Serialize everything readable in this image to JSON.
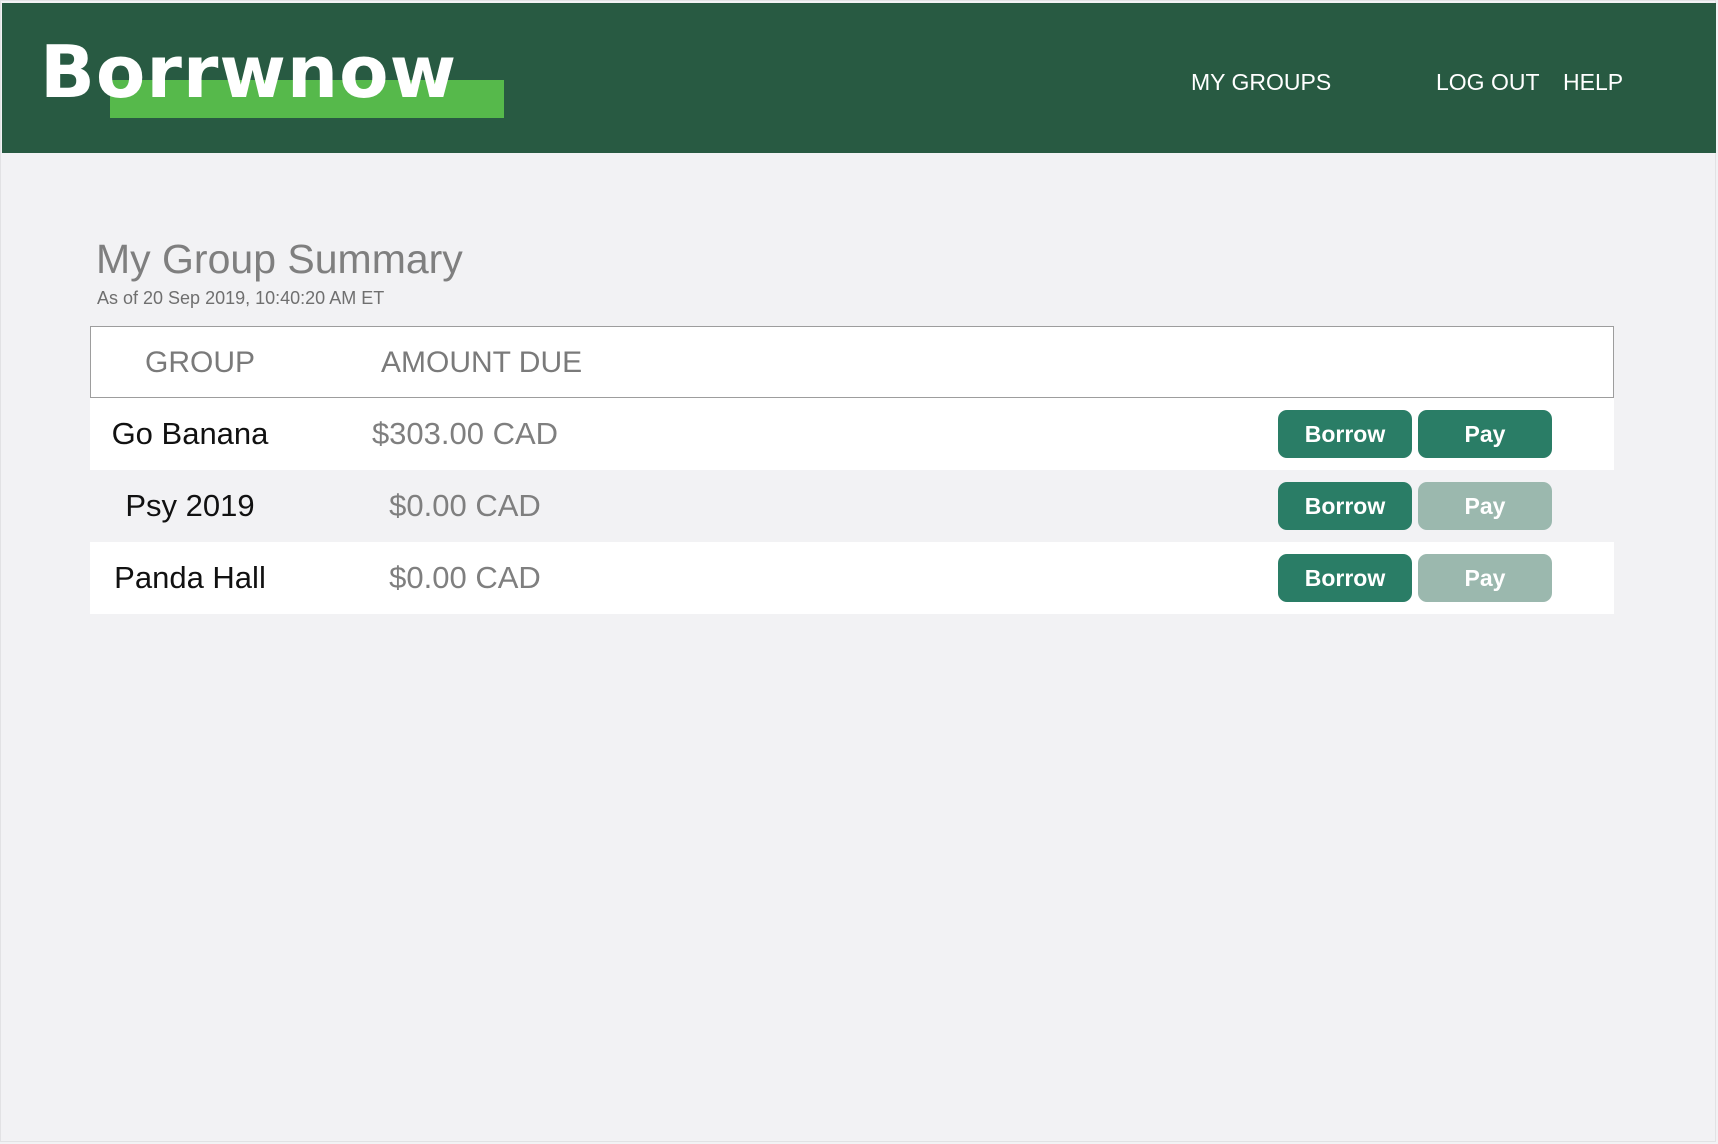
{
  "header": {
    "logo": "Borrwnow",
    "nav": {
      "my_groups": "MY GROUPS",
      "log_out": "LOG OUT",
      "help": "HELP"
    }
  },
  "summary": {
    "title": "My Group Summary",
    "as_of": "As of 20 Sep 2019, 10:40:20 AM ET"
  },
  "table": {
    "columns": {
      "group": "GROUP",
      "amount_due": "AMOUNT DUE"
    },
    "rows": [
      {
        "group": "Go Banana",
        "amount": "$303.00 CAD",
        "borrow": "Borrow",
        "pay": "Pay",
        "pay_enabled": true
      },
      {
        "group": "Psy 2019",
        "amount": "$0.00 CAD",
        "borrow": "Borrow",
        "pay": "Pay",
        "pay_enabled": false
      },
      {
        "group": "Panda Hall",
        "amount": "$0.00 CAD",
        "borrow": "Borrow",
        "pay": "Pay",
        "pay_enabled": false
      }
    ]
  },
  "colors": {
    "header_bg": "#285a42",
    "logo_accent": "#56b94b",
    "button": "#2a7d66",
    "button_disabled": "#9bb8ae",
    "page_bg": "#f2f2f4"
  }
}
